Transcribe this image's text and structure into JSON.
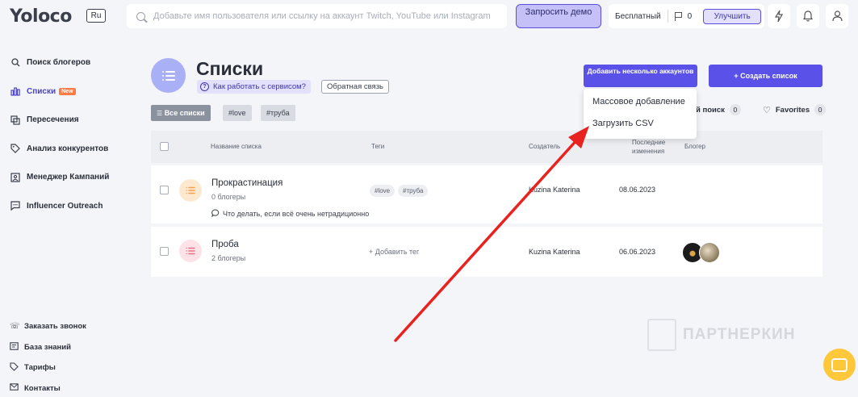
{
  "header": {
    "logo": "Yoloco",
    "lang": "Ru",
    "search_placeholder": "Добавьте имя пользователя или ссылку на аккаунт Twitch, YouTube или Instagram",
    "demo_label": "Запросить демо",
    "plan_label": "Бесплатный",
    "flag_count": "0",
    "upgrade_label": "Улучшить"
  },
  "sidebar": {
    "items": [
      {
        "label": "Поиск блогеров",
        "icon": "search-icon"
      },
      {
        "label": "Списки",
        "icon": "chart-icon",
        "badge": "New"
      },
      {
        "label": "Пересечения",
        "icon": "copy-icon"
      },
      {
        "label": "Анализ конкурентов",
        "icon": "tag-icon"
      },
      {
        "label": "Менеджер Кампаний",
        "icon": "user-box-icon"
      },
      {
        "label": "Influencer Outreach",
        "icon": "chat-icon"
      }
    ],
    "bottom": [
      {
        "label": "Заказать звонок",
        "icon": "phone-icon"
      },
      {
        "label": "База знаний",
        "icon": "book-icon"
      },
      {
        "label": "Тарифы",
        "icon": "price-tag-icon"
      },
      {
        "label": "Контакты",
        "icon": "mail-icon"
      }
    ]
  },
  "page": {
    "title": "Списки",
    "howto_label": "Как работать с сервисом?",
    "feedback_label": "Обратная связь",
    "add_many_label": "Добавить несколько аккаунтов",
    "create_list_label": "+ Создать список",
    "dropdown": [
      "Массовое добавление",
      "Загрузить CSV"
    ]
  },
  "filters": {
    "all_lists": "Все списки",
    "tags": [
      "#love",
      "#труба"
    ],
    "search_label": "й поиск",
    "search_count": "0",
    "favorites_label": "Favorites",
    "favorites_count": "0"
  },
  "table": {
    "columns": [
      "Название списка",
      "Теги",
      "Создатель",
      "Последние изменения",
      "Блогер"
    ],
    "rows": [
      {
        "title": "Прокрастинация",
        "sub": "0 блогеры",
        "note": "Что делать, если всё очень нетрадиционно",
        "tags": [
          "#love",
          "#труба"
        ],
        "creator": "Kuzina Katerina",
        "date": "08.06.2023"
      },
      {
        "title": "Проба",
        "sub": "2 блогеры",
        "add_tag": "+ Добавить тег",
        "creator": "Kuzina Katerina",
        "date": "06.06.2023"
      }
    ]
  },
  "watermark": "ПАРТНЕРКИН",
  "colors": {
    "accent": "#5a52e8",
    "accent_light": "#e3e0fb",
    "arrow": "#e8231f",
    "row1_icon_bg": "#fde9d0",
    "row1_icon": "#f3a24a",
    "row2_icon_bg": "#fde2e7",
    "row2_icon": "#ee6f86"
  }
}
